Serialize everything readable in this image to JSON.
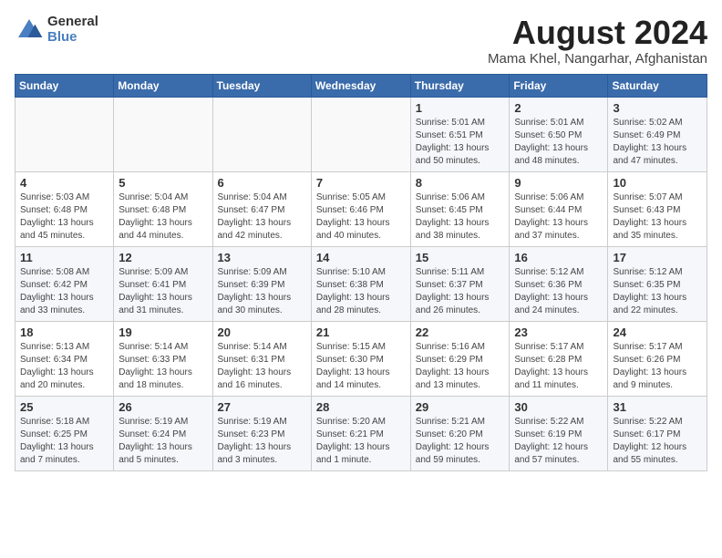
{
  "logo": {
    "general": "General",
    "blue": "Blue"
  },
  "title": "August 2024",
  "location": "Mama Khel, Nangarhar, Afghanistan",
  "headers": [
    "Sunday",
    "Monday",
    "Tuesday",
    "Wednesday",
    "Thursday",
    "Friday",
    "Saturday"
  ],
  "weeks": [
    [
      {
        "day": "",
        "info": ""
      },
      {
        "day": "",
        "info": ""
      },
      {
        "day": "",
        "info": ""
      },
      {
        "day": "",
        "info": ""
      },
      {
        "day": "1",
        "info": "Sunrise: 5:01 AM\nSunset: 6:51 PM\nDaylight: 13 hours\nand 50 minutes."
      },
      {
        "day": "2",
        "info": "Sunrise: 5:01 AM\nSunset: 6:50 PM\nDaylight: 13 hours\nand 48 minutes."
      },
      {
        "day": "3",
        "info": "Sunrise: 5:02 AM\nSunset: 6:49 PM\nDaylight: 13 hours\nand 47 minutes."
      }
    ],
    [
      {
        "day": "4",
        "info": "Sunrise: 5:03 AM\nSunset: 6:48 PM\nDaylight: 13 hours\nand 45 minutes."
      },
      {
        "day": "5",
        "info": "Sunrise: 5:04 AM\nSunset: 6:48 PM\nDaylight: 13 hours\nand 44 minutes."
      },
      {
        "day": "6",
        "info": "Sunrise: 5:04 AM\nSunset: 6:47 PM\nDaylight: 13 hours\nand 42 minutes."
      },
      {
        "day": "7",
        "info": "Sunrise: 5:05 AM\nSunset: 6:46 PM\nDaylight: 13 hours\nand 40 minutes."
      },
      {
        "day": "8",
        "info": "Sunrise: 5:06 AM\nSunset: 6:45 PM\nDaylight: 13 hours\nand 38 minutes."
      },
      {
        "day": "9",
        "info": "Sunrise: 5:06 AM\nSunset: 6:44 PM\nDaylight: 13 hours\nand 37 minutes."
      },
      {
        "day": "10",
        "info": "Sunrise: 5:07 AM\nSunset: 6:43 PM\nDaylight: 13 hours\nand 35 minutes."
      }
    ],
    [
      {
        "day": "11",
        "info": "Sunrise: 5:08 AM\nSunset: 6:42 PM\nDaylight: 13 hours\nand 33 minutes."
      },
      {
        "day": "12",
        "info": "Sunrise: 5:09 AM\nSunset: 6:41 PM\nDaylight: 13 hours\nand 31 minutes."
      },
      {
        "day": "13",
        "info": "Sunrise: 5:09 AM\nSunset: 6:39 PM\nDaylight: 13 hours\nand 30 minutes."
      },
      {
        "day": "14",
        "info": "Sunrise: 5:10 AM\nSunset: 6:38 PM\nDaylight: 13 hours\nand 28 minutes."
      },
      {
        "day": "15",
        "info": "Sunrise: 5:11 AM\nSunset: 6:37 PM\nDaylight: 13 hours\nand 26 minutes."
      },
      {
        "day": "16",
        "info": "Sunrise: 5:12 AM\nSunset: 6:36 PM\nDaylight: 13 hours\nand 24 minutes."
      },
      {
        "day": "17",
        "info": "Sunrise: 5:12 AM\nSunset: 6:35 PM\nDaylight: 13 hours\nand 22 minutes."
      }
    ],
    [
      {
        "day": "18",
        "info": "Sunrise: 5:13 AM\nSunset: 6:34 PM\nDaylight: 13 hours\nand 20 minutes."
      },
      {
        "day": "19",
        "info": "Sunrise: 5:14 AM\nSunset: 6:33 PM\nDaylight: 13 hours\nand 18 minutes."
      },
      {
        "day": "20",
        "info": "Sunrise: 5:14 AM\nSunset: 6:31 PM\nDaylight: 13 hours\nand 16 minutes."
      },
      {
        "day": "21",
        "info": "Sunrise: 5:15 AM\nSunset: 6:30 PM\nDaylight: 13 hours\nand 14 minutes."
      },
      {
        "day": "22",
        "info": "Sunrise: 5:16 AM\nSunset: 6:29 PM\nDaylight: 13 hours\nand 13 minutes."
      },
      {
        "day": "23",
        "info": "Sunrise: 5:17 AM\nSunset: 6:28 PM\nDaylight: 13 hours\nand 11 minutes."
      },
      {
        "day": "24",
        "info": "Sunrise: 5:17 AM\nSunset: 6:26 PM\nDaylight: 13 hours\nand 9 minutes."
      }
    ],
    [
      {
        "day": "25",
        "info": "Sunrise: 5:18 AM\nSunset: 6:25 PM\nDaylight: 13 hours\nand 7 minutes."
      },
      {
        "day": "26",
        "info": "Sunrise: 5:19 AM\nSunset: 6:24 PM\nDaylight: 13 hours\nand 5 minutes."
      },
      {
        "day": "27",
        "info": "Sunrise: 5:19 AM\nSunset: 6:23 PM\nDaylight: 13 hours\nand 3 minutes."
      },
      {
        "day": "28",
        "info": "Sunrise: 5:20 AM\nSunset: 6:21 PM\nDaylight: 13 hours\nand 1 minute."
      },
      {
        "day": "29",
        "info": "Sunrise: 5:21 AM\nSunset: 6:20 PM\nDaylight: 12 hours\nand 59 minutes."
      },
      {
        "day": "30",
        "info": "Sunrise: 5:22 AM\nSunset: 6:19 PM\nDaylight: 12 hours\nand 57 minutes."
      },
      {
        "day": "31",
        "info": "Sunrise: 5:22 AM\nSunset: 6:17 PM\nDaylight: 12 hours\nand 55 minutes."
      }
    ]
  ]
}
